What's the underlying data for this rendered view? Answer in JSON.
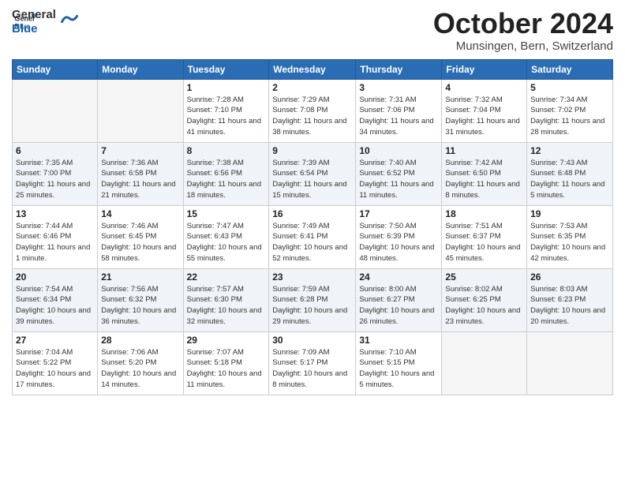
{
  "header": {
    "logo_general": "General",
    "logo_blue": "Blue",
    "month": "October 2024",
    "location": "Munsingen, Bern, Switzerland"
  },
  "weekdays": [
    "Sunday",
    "Monday",
    "Tuesday",
    "Wednesday",
    "Thursday",
    "Friday",
    "Saturday"
  ],
  "weeks": [
    [
      {
        "day": "",
        "sunrise": "",
        "sunset": "",
        "daylight": ""
      },
      {
        "day": "",
        "sunrise": "",
        "sunset": "",
        "daylight": ""
      },
      {
        "day": "1",
        "sunrise": "Sunrise: 7:28 AM",
        "sunset": "Sunset: 7:10 PM",
        "daylight": "Daylight: 11 hours and 41 minutes."
      },
      {
        "day": "2",
        "sunrise": "Sunrise: 7:29 AM",
        "sunset": "Sunset: 7:08 PM",
        "daylight": "Daylight: 11 hours and 38 minutes."
      },
      {
        "day": "3",
        "sunrise": "Sunrise: 7:31 AM",
        "sunset": "Sunset: 7:06 PM",
        "daylight": "Daylight: 11 hours and 34 minutes."
      },
      {
        "day": "4",
        "sunrise": "Sunrise: 7:32 AM",
        "sunset": "Sunset: 7:04 PM",
        "daylight": "Daylight: 11 hours and 31 minutes."
      },
      {
        "day": "5",
        "sunrise": "Sunrise: 7:34 AM",
        "sunset": "Sunset: 7:02 PM",
        "daylight": "Daylight: 11 hours and 28 minutes."
      }
    ],
    [
      {
        "day": "6",
        "sunrise": "Sunrise: 7:35 AM",
        "sunset": "Sunset: 7:00 PM",
        "daylight": "Daylight: 11 hours and 25 minutes."
      },
      {
        "day": "7",
        "sunrise": "Sunrise: 7:36 AM",
        "sunset": "Sunset: 6:58 PM",
        "daylight": "Daylight: 11 hours and 21 minutes."
      },
      {
        "day": "8",
        "sunrise": "Sunrise: 7:38 AM",
        "sunset": "Sunset: 6:56 PM",
        "daylight": "Daylight: 11 hours and 18 minutes."
      },
      {
        "day": "9",
        "sunrise": "Sunrise: 7:39 AM",
        "sunset": "Sunset: 6:54 PM",
        "daylight": "Daylight: 11 hours and 15 minutes."
      },
      {
        "day": "10",
        "sunrise": "Sunrise: 7:40 AM",
        "sunset": "Sunset: 6:52 PM",
        "daylight": "Daylight: 11 hours and 11 minutes."
      },
      {
        "day": "11",
        "sunrise": "Sunrise: 7:42 AM",
        "sunset": "Sunset: 6:50 PM",
        "daylight": "Daylight: 11 hours and 8 minutes."
      },
      {
        "day": "12",
        "sunrise": "Sunrise: 7:43 AM",
        "sunset": "Sunset: 6:48 PM",
        "daylight": "Daylight: 11 hours and 5 minutes."
      }
    ],
    [
      {
        "day": "13",
        "sunrise": "Sunrise: 7:44 AM",
        "sunset": "Sunset: 6:46 PM",
        "daylight": "Daylight: 11 hours and 1 minute."
      },
      {
        "day": "14",
        "sunrise": "Sunrise: 7:46 AM",
        "sunset": "Sunset: 6:45 PM",
        "daylight": "Daylight: 10 hours and 58 minutes."
      },
      {
        "day": "15",
        "sunrise": "Sunrise: 7:47 AM",
        "sunset": "Sunset: 6:43 PM",
        "daylight": "Daylight: 10 hours and 55 minutes."
      },
      {
        "day": "16",
        "sunrise": "Sunrise: 7:49 AM",
        "sunset": "Sunset: 6:41 PM",
        "daylight": "Daylight: 10 hours and 52 minutes."
      },
      {
        "day": "17",
        "sunrise": "Sunrise: 7:50 AM",
        "sunset": "Sunset: 6:39 PM",
        "daylight": "Daylight: 10 hours and 48 minutes."
      },
      {
        "day": "18",
        "sunrise": "Sunrise: 7:51 AM",
        "sunset": "Sunset: 6:37 PM",
        "daylight": "Daylight: 10 hours and 45 minutes."
      },
      {
        "day": "19",
        "sunrise": "Sunrise: 7:53 AM",
        "sunset": "Sunset: 6:35 PM",
        "daylight": "Daylight: 10 hours and 42 minutes."
      }
    ],
    [
      {
        "day": "20",
        "sunrise": "Sunrise: 7:54 AM",
        "sunset": "Sunset: 6:34 PM",
        "daylight": "Daylight: 10 hours and 39 minutes."
      },
      {
        "day": "21",
        "sunrise": "Sunrise: 7:56 AM",
        "sunset": "Sunset: 6:32 PM",
        "daylight": "Daylight: 10 hours and 36 minutes."
      },
      {
        "day": "22",
        "sunrise": "Sunrise: 7:57 AM",
        "sunset": "Sunset: 6:30 PM",
        "daylight": "Daylight: 10 hours and 32 minutes."
      },
      {
        "day": "23",
        "sunrise": "Sunrise: 7:59 AM",
        "sunset": "Sunset: 6:28 PM",
        "daylight": "Daylight: 10 hours and 29 minutes."
      },
      {
        "day": "24",
        "sunrise": "Sunrise: 8:00 AM",
        "sunset": "Sunset: 6:27 PM",
        "daylight": "Daylight: 10 hours and 26 minutes."
      },
      {
        "day": "25",
        "sunrise": "Sunrise: 8:02 AM",
        "sunset": "Sunset: 6:25 PM",
        "daylight": "Daylight: 10 hours and 23 minutes."
      },
      {
        "day": "26",
        "sunrise": "Sunrise: 8:03 AM",
        "sunset": "Sunset: 6:23 PM",
        "daylight": "Daylight: 10 hours and 20 minutes."
      }
    ],
    [
      {
        "day": "27",
        "sunrise": "Sunrise: 7:04 AM",
        "sunset": "Sunset: 5:22 PM",
        "daylight": "Daylight: 10 hours and 17 minutes."
      },
      {
        "day": "28",
        "sunrise": "Sunrise: 7:06 AM",
        "sunset": "Sunset: 5:20 PM",
        "daylight": "Daylight: 10 hours and 14 minutes."
      },
      {
        "day": "29",
        "sunrise": "Sunrise: 7:07 AM",
        "sunset": "Sunset: 5:18 PM",
        "daylight": "Daylight: 10 hours and 11 minutes."
      },
      {
        "day": "30",
        "sunrise": "Sunrise: 7:09 AM",
        "sunset": "Sunset: 5:17 PM",
        "daylight": "Daylight: 10 hours and 8 minutes."
      },
      {
        "day": "31",
        "sunrise": "Sunrise: 7:10 AM",
        "sunset": "Sunset: 5:15 PM",
        "daylight": "Daylight: 10 hours and 5 minutes."
      },
      {
        "day": "",
        "sunrise": "",
        "sunset": "",
        "daylight": ""
      },
      {
        "day": "",
        "sunrise": "",
        "sunset": "",
        "daylight": ""
      }
    ]
  ]
}
